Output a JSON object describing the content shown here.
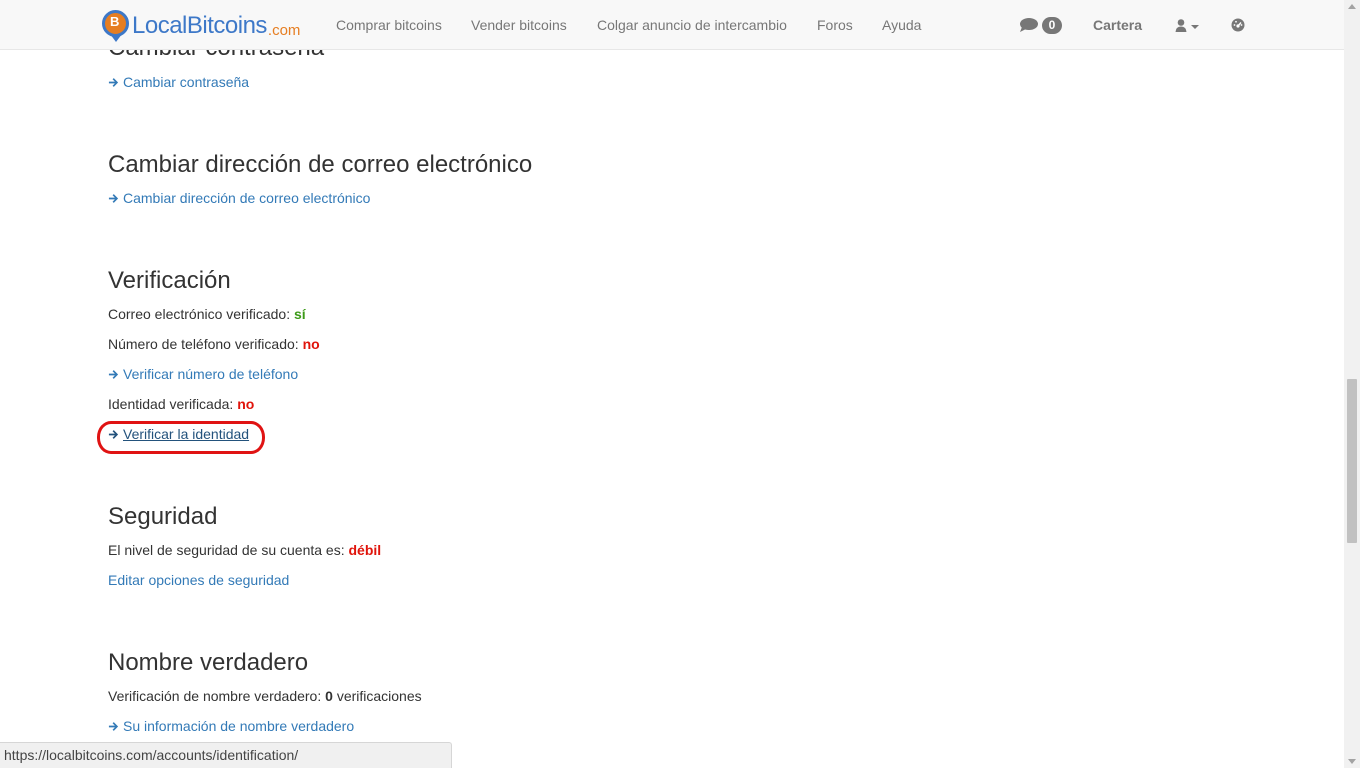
{
  "navbar": {
    "brand_name": "LocalBitcoins",
    "brand_suffix": ".com",
    "links": [
      "Comprar bitcoins",
      "Vender bitcoins",
      "Colgar anuncio de intercambio",
      "Foros",
      "Ayuda"
    ],
    "messages_count": "0",
    "wallet_label": "Cartera",
    "icons": {
      "messages": "comment-icon",
      "user_menu": "user-icon",
      "dashboard": "dashboard-icon"
    }
  },
  "sections": {
    "password": {
      "heading": "Cambiar contraseña",
      "link": "Cambiar contraseña"
    },
    "email": {
      "heading": "Cambiar dirección de correo electrónico",
      "link": "Cambiar dirección de correo electrónico"
    },
    "verification": {
      "heading": "Verificación",
      "email_label": "Correo electrónico verificado:",
      "email_value": "sí",
      "phone_label": "Número de teléfono verificado:",
      "phone_value": "no",
      "phone_link": "Verificar número de teléfono",
      "identity_label": "Identidad verificada:",
      "identity_value": "no",
      "identity_link": "Verificar la identidad"
    },
    "security": {
      "heading": "Seguridad",
      "level_label": "El nivel de seguridad de su cuenta es:",
      "level_value": "débil",
      "edit_link": "Editar opciones de seguridad"
    },
    "real_name": {
      "heading": "Nombre verdadero",
      "label": "Verificación de nombre verdadero:",
      "count": "0",
      "count_suffix": "verificaciones",
      "link": "Su información de nombre verdadero"
    }
  },
  "statusbar": {
    "url": "https://localbitcoins.com/accounts/identification/"
  },
  "colors": {
    "link": "#337ab7",
    "positive": "#3c9a18",
    "negative": "#e0140b",
    "annotation": "#e01313",
    "brand_blue": "#3d78c8",
    "brand_orange": "#e67e22"
  }
}
